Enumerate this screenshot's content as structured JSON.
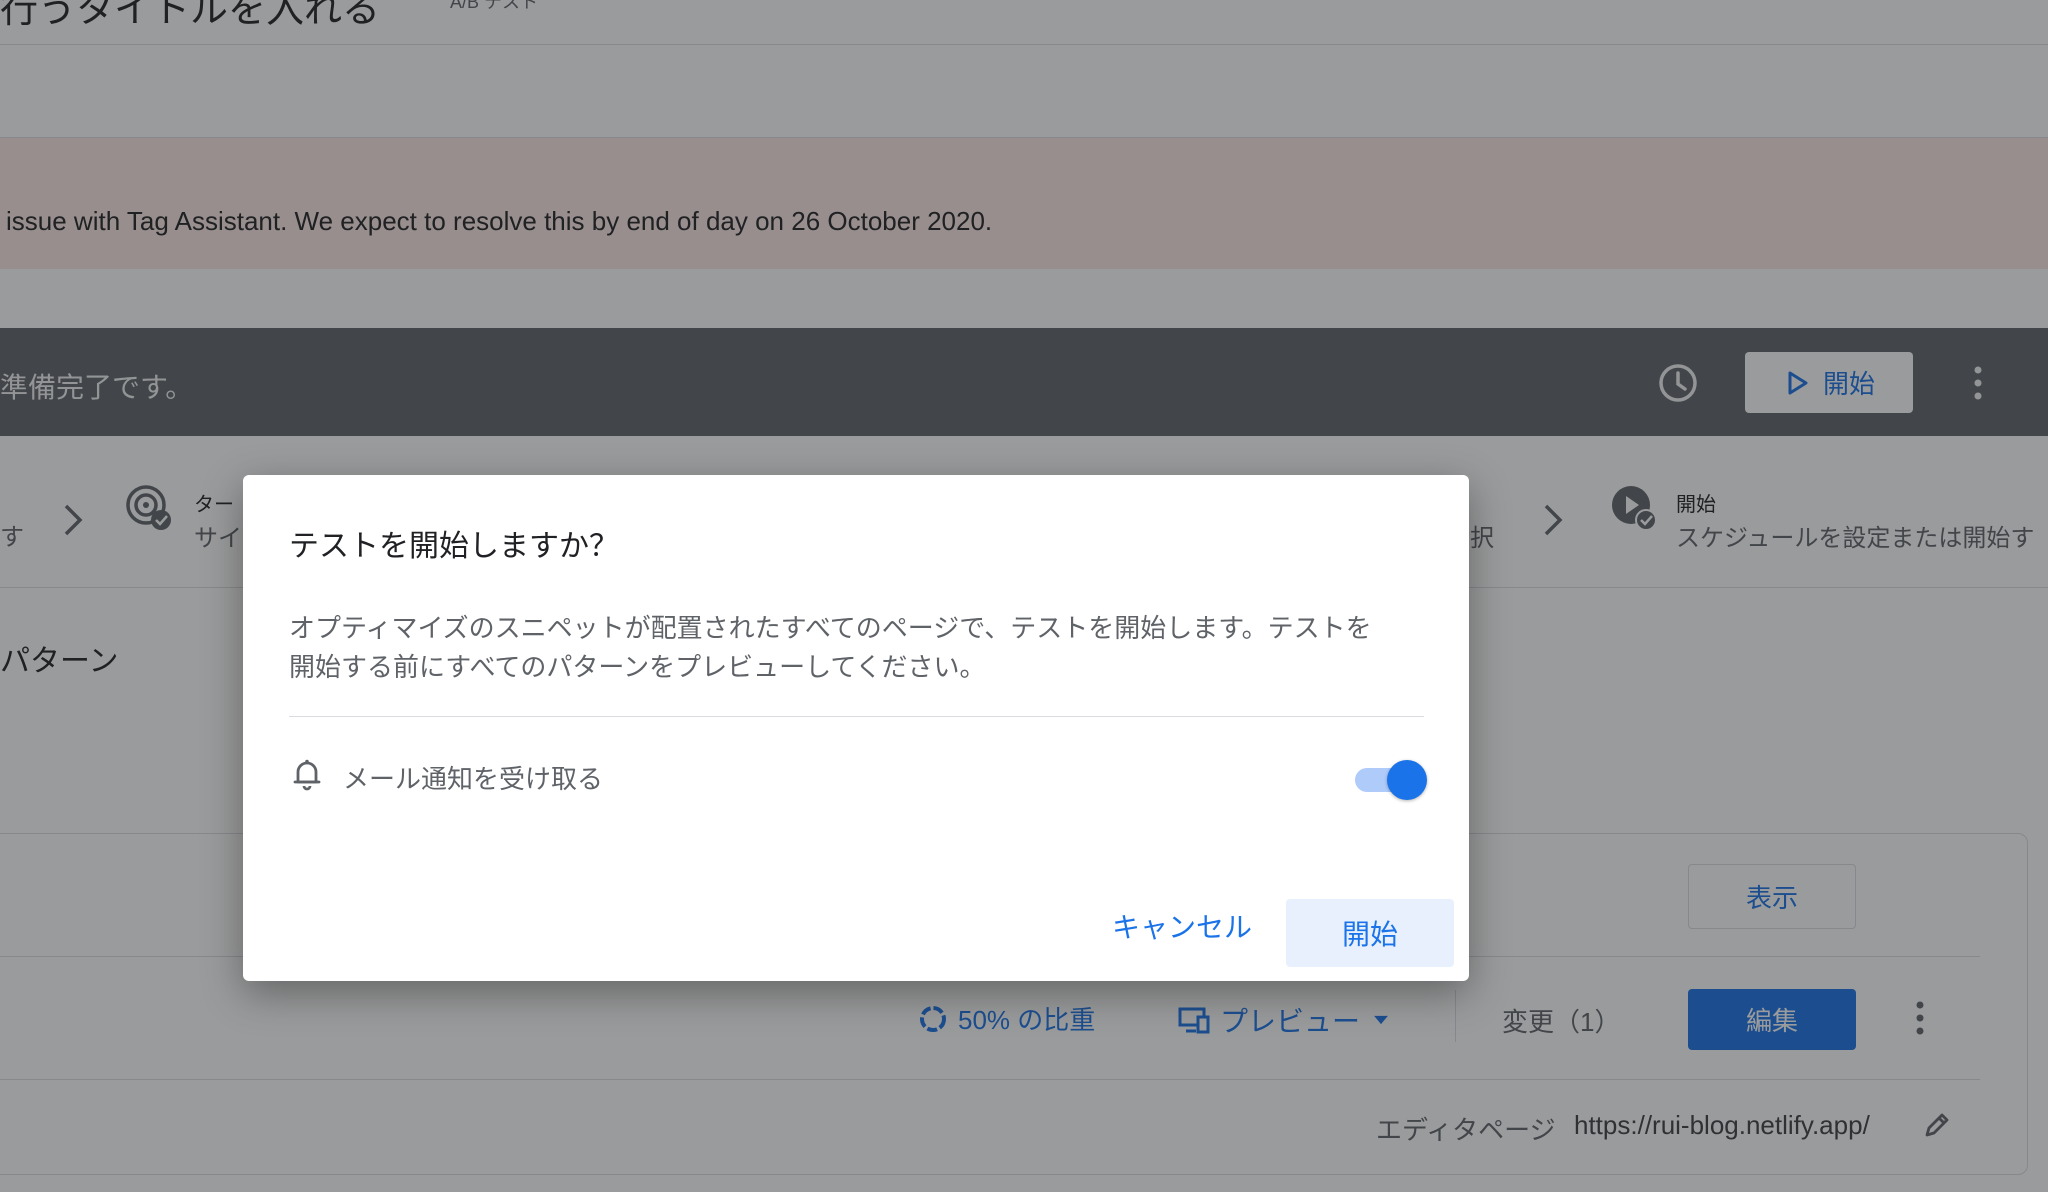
{
  "header": {
    "title": "行うタイトルを入れる",
    "subtitle": "A/B テスト"
  },
  "banner": {
    "text": "issue with Tag Assistant. We expect to resolve this by end of day on 26 October 2020."
  },
  "status_bar": {
    "text": "準備完了です。",
    "start_label": "開始",
    "icons": [
      "clock-icon",
      "play-icon",
      "more-vert-icon"
    ]
  },
  "steps": {
    "fragment_left": "す",
    "targeting": {
      "title": "ター",
      "desc": "サイ"
    },
    "fragment_mid": "択",
    "start": {
      "title": "開始",
      "desc": "スケジュールを設定または開始す"
    }
  },
  "patterns": {
    "heading": "パターン",
    "view_label": "表示",
    "weight_label": "50% の比重",
    "preview_label": "プレビュー",
    "changes_label": "変更（1）",
    "edit_label": "編集",
    "editor_label": "エディタページ",
    "editor_url": "https://rui-blog.netlify.app/"
  },
  "dialog": {
    "title": "テストを開始しますか？",
    "body_line1": "オプティマイズのスニペットが配置されたすべてのページで、テストを開始します。テストを",
    "body_line2": "開始する前にすべてのパターンをプレビューしてください。",
    "notify_label": "メール通知を受け取る",
    "notify_enabled": true,
    "cancel_label": "キャンセル",
    "start_label": "開始"
  },
  "colors": {
    "accent": "#1a73e8",
    "status_bar": "#5f6368",
    "banner": "#fce8e6"
  }
}
